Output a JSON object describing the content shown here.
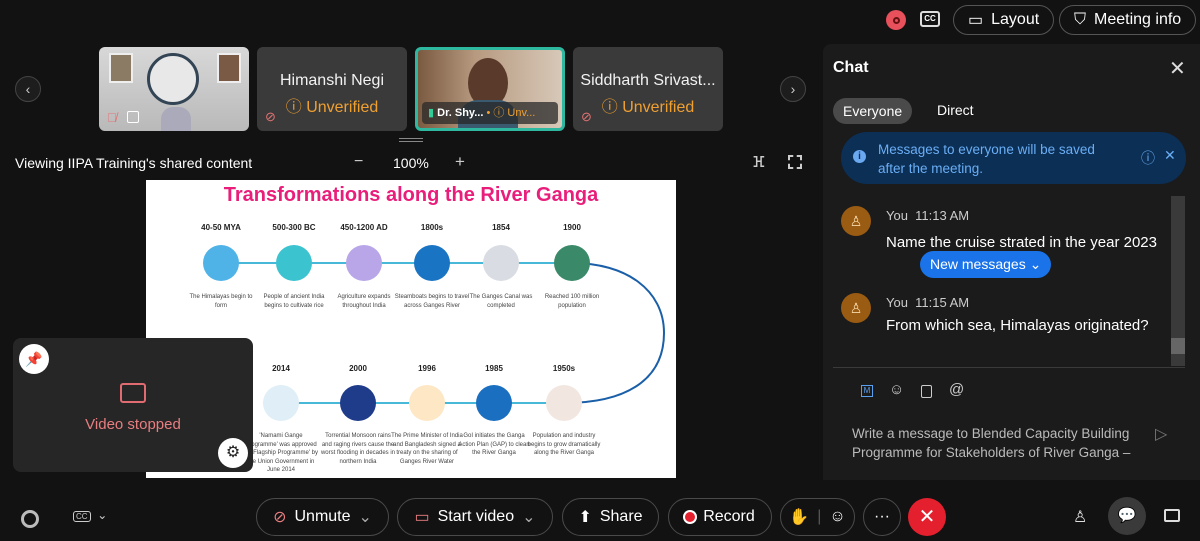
{
  "top_bar": {
    "layout_label": "Layout",
    "meeting_info_label": "Meeting info",
    "cc_label": "CC"
  },
  "participants": [
    {
      "name": "",
      "type": "video"
    },
    {
      "name": "Himanshi Negi",
      "status": "Unverified"
    },
    {
      "name": "Dr. Shy...",
      "status": "Unv...",
      "active": true
    },
    {
      "name": "Siddharth Srivast...",
      "status": "Unverified"
    }
  ],
  "share_bar": {
    "viewing_text": "Viewing IIPA Training's shared content",
    "zoom": "100%",
    "zoom_out": "−",
    "zoom_in": "+"
  },
  "slide": {
    "title": "Transformations along the River Ganga",
    "top_row": [
      {
        "year": "40-50 MYA",
        "desc": "The Himalayas begin to form",
        "color": "#4fb3e8"
      },
      {
        "year": "500-300 BC",
        "desc": "People of ancient India begins to cultivate rice",
        "color": "#3cc3d0"
      },
      {
        "year": "450-1200 AD",
        "desc": "Agriculture expands throughout India",
        "color": "#b8a6e8"
      },
      {
        "year": "1800s",
        "desc": "Steamboats begins to travel across Ganges River",
        "color": "#1a74c4"
      },
      {
        "year": "1854",
        "desc": "The Ganges Canal was completed",
        "color": "#d9dde3"
      },
      {
        "year": "1900",
        "desc": "Reached 100 million population",
        "color": "#3a8a6a"
      }
    ],
    "bottom_row": [
      {
        "year": "2014",
        "desc": "'Namami Gange Programme' was approved as 'Flagship Programme' by the Union Government in June 2014",
        "color": "#dfeef7"
      },
      {
        "year": "2000",
        "desc": "Torrential Monsoon rains and raging rivers cause the worst flooding in decades in northern India",
        "color": "#1f3c8a"
      },
      {
        "year": "1996",
        "desc": "The Prime Minister of India and Bangladesh signed a treaty on the sharing of Ganges River Water",
        "color": "#fde7c4"
      },
      {
        "year": "1985",
        "desc": "GoI initiates the Ganga Action Plan (GAP) to clean the River Ganga",
        "color": "#1a6fc0"
      },
      {
        "year": "1950s",
        "desc": "Population and industry begins to grow dramatically along the River Ganga",
        "color": "#f2e6e0"
      }
    ]
  },
  "self_view": {
    "status": "Video stopped"
  },
  "chat": {
    "title": "Chat",
    "tabs": [
      "Everyone",
      "Direct"
    ],
    "notice": "Messages to everyone will be saved after the meeting.",
    "messages": [
      {
        "sender": "You",
        "time": "11:13 AM",
        "text": "Name the cruise strated in the year 2023"
      },
      {
        "sender": "You",
        "time": "11:15 AM",
        "text": "From which sea, Himalayas originated?"
      }
    ],
    "new_messages": "New messages",
    "input_placeholder": "Write a message to Blended Capacity Building Programme for Stakeholders of River Ganga –"
  },
  "controls": {
    "unmute": "Unmute",
    "start_video": "Start video",
    "share": "Share",
    "record": "Record",
    "more": "···"
  },
  "colors": {
    "accent": "#1a73e8",
    "leave": "#e5202e",
    "unverified": "#f0a030",
    "slide_title": "#e91e7b"
  }
}
